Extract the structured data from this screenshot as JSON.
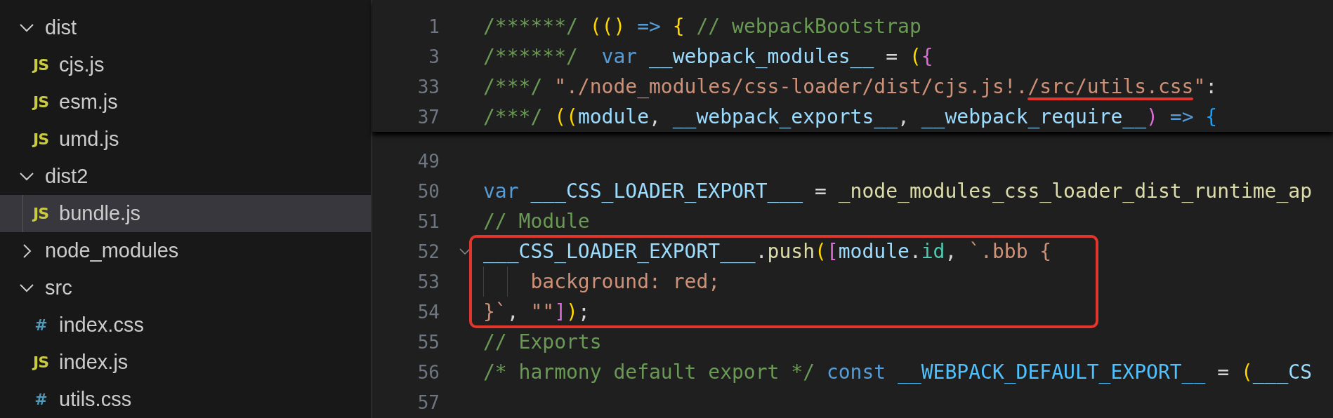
{
  "explorer": {
    "items": [
      {
        "kind": "folder",
        "label": "dist",
        "expanded": true,
        "selected": false,
        "children": [
          {
            "kind": "js",
            "icon": "JS",
            "label": "cjs.js",
            "selected": false
          },
          {
            "kind": "js",
            "icon": "JS",
            "label": "esm.js",
            "selected": false
          },
          {
            "kind": "js",
            "icon": "JS",
            "label": "umd.js",
            "selected": false
          }
        ]
      },
      {
        "kind": "folder",
        "label": "dist2",
        "expanded": true,
        "selected": false,
        "children": [
          {
            "kind": "js",
            "icon": "JS",
            "label": "bundle.js",
            "selected": true
          }
        ]
      },
      {
        "kind": "folder",
        "label": "node_modules",
        "expanded": false,
        "selected": false
      },
      {
        "kind": "folder",
        "label": "src",
        "expanded": true,
        "selected": false,
        "children": [
          {
            "kind": "css",
            "icon": "#",
            "label": "index.css",
            "selected": false
          },
          {
            "kind": "js",
            "icon": "JS",
            "label": "index.js",
            "selected": false
          },
          {
            "kind": "css",
            "icon": "#",
            "label": "utils.css",
            "selected": false
          }
        ]
      }
    ]
  },
  "editor": {
    "sticky_lines": [
      {
        "number": "1",
        "tokens": [
          {
            "kind": "comment",
            "text": "/******/ "
          },
          {
            "kind": "bracket1",
            "text": "(() "
          },
          {
            "kind": "keyword",
            "text": "=> "
          },
          {
            "kind": "bracket1",
            "text": "{ "
          },
          {
            "kind": "comment",
            "text": "// webpackBootstrap"
          }
        ]
      },
      {
        "number": "3",
        "tokens": [
          {
            "kind": "comment",
            "text": "/******/  "
          },
          {
            "kind": "keyword",
            "text": "var "
          },
          {
            "kind": "variable",
            "text": "__webpack_modules__ "
          },
          {
            "kind": "plain",
            "text": "= "
          },
          {
            "kind": "bracket1",
            "text": "("
          },
          {
            "kind": "bracket2",
            "text": "{"
          }
        ]
      },
      {
        "number": "33",
        "tokens": [
          {
            "kind": "comment",
            "text": "/***/ "
          },
          {
            "kind": "string",
            "text": "\"./node_modules/css-loader/dist/cjs.js!."
          },
          {
            "kind": "string",
            "text": "/src/utils.css",
            "underlined": true
          },
          {
            "kind": "string",
            "text": "\""
          },
          {
            "kind": "plain",
            "text": ":"
          }
        ]
      },
      {
        "number": "37",
        "tokens": [
          {
            "kind": "comment",
            "text": "/***/ "
          },
          {
            "kind": "bracket1",
            "text": "(("
          },
          {
            "kind": "variable",
            "text": "module"
          },
          {
            "kind": "plain",
            "text": ", "
          },
          {
            "kind": "variable",
            "text": "__webpack_exports__"
          },
          {
            "kind": "plain",
            "text": ", "
          },
          {
            "kind": "variable",
            "text": "__webpack_require__"
          },
          {
            "kind": "bracket2",
            "text": ") "
          },
          {
            "kind": "keyword",
            "text": "=> "
          },
          {
            "kind": "bracket3",
            "text": "{"
          }
        ]
      }
    ],
    "lines": [
      {
        "number": "49",
        "boxed": false,
        "foldable": false
      },
      {
        "number": "50",
        "boxed": false,
        "foldable": false,
        "tokens": [
          {
            "kind": "keyword",
            "text": "var "
          },
          {
            "kind": "variable",
            "text": "___CSS_LOADER_EXPORT___ "
          },
          {
            "kind": "plain",
            "text": "= "
          },
          {
            "kind": "function",
            "text": "_node_modules_css_loader_dist_runtime_ap"
          }
        ]
      },
      {
        "number": "51",
        "boxed": false,
        "foldable": false,
        "tokens": [
          {
            "kind": "comment",
            "text": "// Module"
          }
        ]
      },
      {
        "number": "52",
        "boxed": true,
        "foldable": true,
        "tokens": [
          {
            "kind": "variable",
            "text": "___CSS_LOADER_EXPORT___"
          },
          {
            "kind": "plain",
            "text": "."
          },
          {
            "kind": "function",
            "text": "push"
          },
          {
            "kind": "bracket1",
            "text": "("
          },
          {
            "kind": "bracket2",
            "text": "["
          },
          {
            "kind": "variable",
            "text": "module"
          },
          {
            "kind": "plain",
            "text": "."
          },
          {
            "kind": "property",
            "text": "id"
          },
          {
            "kind": "plain",
            "text": ", "
          },
          {
            "kind": "string",
            "text": "`.bbb {"
          }
        ]
      },
      {
        "number": "53",
        "boxed": true,
        "foldable": false,
        "tokens": [
          {
            "kind": "string",
            "text": "    background: red;"
          }
        ]
      },
      {
        "number": "54",
        "boxed": true,
        "foldable": false,
        "tokens": [
          {
            "kind": "string",
            "text": "}`"
          },
          {
            "kind": "plain",
            "text": ", "
          },
          {
            "kind": "string",
            "text": "\"\""
          },
          {
            "kind": "bracket2",
            "text": "]"
          },
          {
            "kind": "bracket1",
            "text": ")"
          },
          {
            "kind": "plain",
            "text": ";"
          }
        ]
      },
      {
        "number": "55",
        "boxed": false,
        "foldable": false,
        "tokens": [
          {
            "kind": "comment",
            "text": "// Exports"
          }
        ]
      },
      {
        "number": "56",
        "boxed": false,
        "foldable": false,
        "tokens": [
          {
            "kind": "comment",
            "text": "/* harmony default export */ "
          },
          {
            "kind": "keyword",
            "text": "const "
          },
          {
            "kind": "constant",
            "text": "__WEBPACK_DEFAULT_EXPORT__ "
          },
          {
            "kind": "plain",
            "text": "= "
          },
          {
            "kind": "bracket1",
            "text": "("
          },
          {
            "kind": "variable",
            "text": "___CS"
          }
        ]
      },
      {
        "number": "57",
        "boxed": false,
        "foldable": false
      }
    ]
  }
}
